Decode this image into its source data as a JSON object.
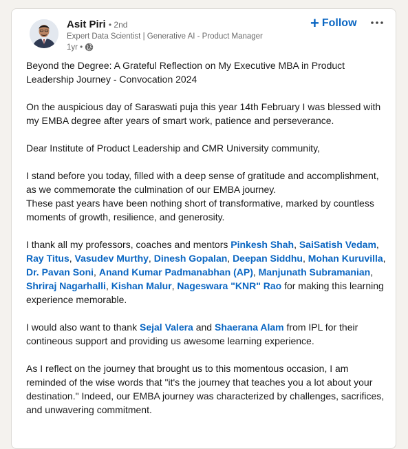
{
  "author": {
    "name": "Asit Piri",
    "degree": "• 2nd",
    "headline": "Expert Data Scientist | Generative AI - Product Manager",
    "time": "1yr •"
  },
  "actions": {
    "follow_label": "Follow"
  },
  "icons": {
    "follow": "plus-icon",
    "more": "more-options-icon",
    "visibility": "globe-icon"
  },
  "colors": {
    "link": "#0a66c2",
    "text": "#191919",
    "secondary_text": "#666666"
  },
  "post": {
    "p1": "Beyond the Degree: A Grateful Reflection on My Executive MBA in Product Leadership Journey - Convocation 2024",
    "p2": "On the auspicious day of Saraswati puja this year 14th February I was blessed with my EMBA degree after years of smart work, patience and perseverance.",
    "p3": "Dear Institute of Product Leadership and CMR University community,",
    "p4a": "I stand before you today, filled with a deep sense of gratitude and accomplishment, as we commemorate the culmination of our EMBA journey.",
    "p4b": "These past years have been nothing short of transformative, marked by countless moments of growth, resilience, and generosity.",
    "p5_intro": "I thank all my professors, coaches and mentors",
    "mentors": [
      "Pinkesh Shah",
      "SaiSatish Vedam",
      "Ray Titus",
      "Vasudev Murthy",
      "Dinesh Gopalan",
      "Deepan Siddhu",
      "Mohan Kuruvilla",
      "Dr. Pavan Soni",
      "Anand Kumar Padmanabhan (AP)",
      "Manjunath Subramanian",
      "Shriraj Nagarhalli",
      "Kishan Malur",
      "Nageswara \"KNR\" Rao"
    ],
    "p5_outro": "for making this learning experience memorable.",
    "p6_intro": "I would also want to thank",
    "p6_mention1": "Sejal Valera",
    "p6_and": "and",
    "p6_mention2": "Shaerana Alam",
    "p6_outro": "from IPL for their contineous support and providing us awesome learning experience.",
    "p7": "As I reflect on the journey that brought us to this momentous occasion, I am reminded of the wise words that \"it's the journey that teaches you a lot about your destination.\" Indeed, our EMBA journey was characterized by challenges, sacrifices, and unwavering commitment."
  }
}
